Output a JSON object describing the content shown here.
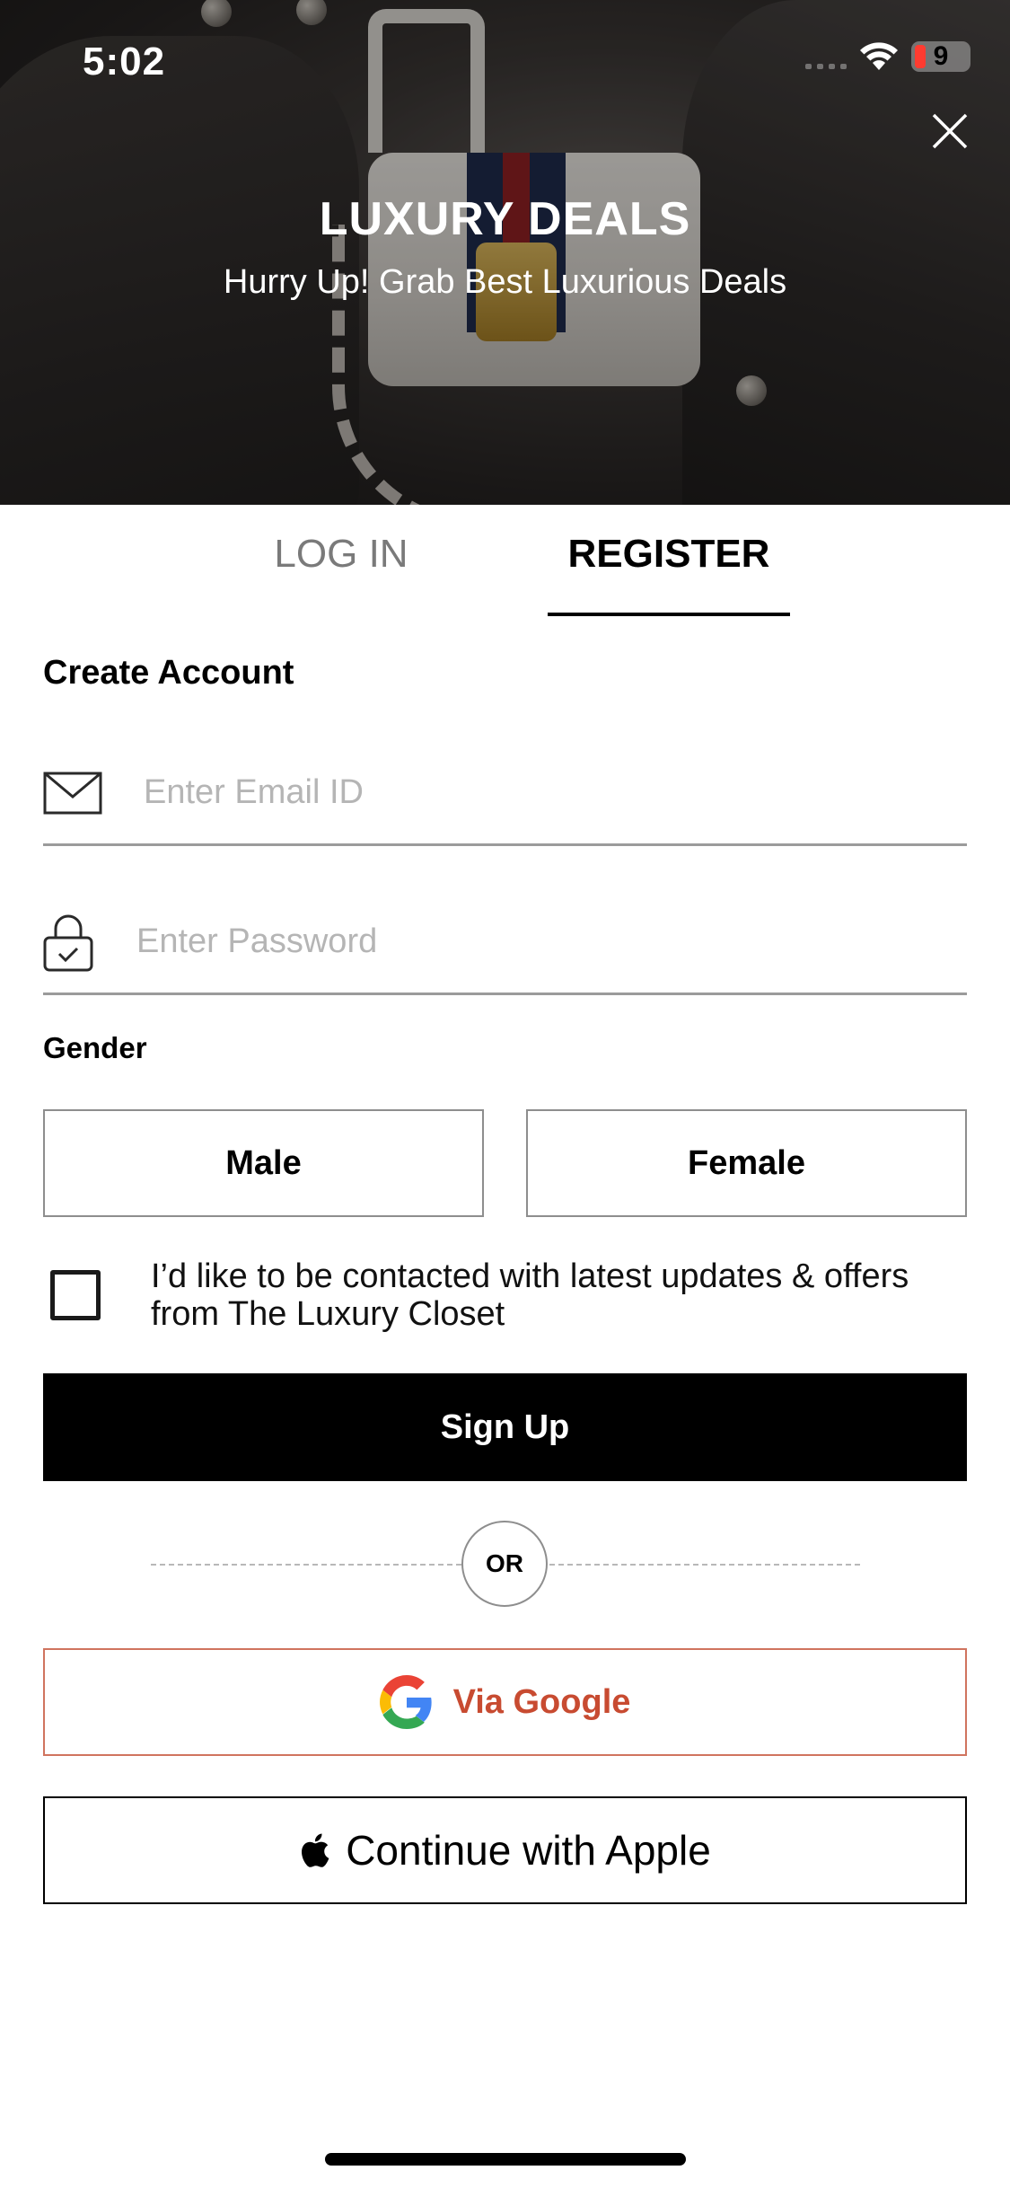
{
  "status_bar": {
    "time": "5:02",
    "battery_level": "9"
  },
  "hero": {
    "title": "LUXURY DEALS",
    "subtitle": "Hurry Up! Grab Best Luxurious Deals"
  },
  "tabs": [
    {
      "label": "LOG IN",
      "active": false
    },
    {
      "label": "REGISTER",
      "active": true
    }
  ],
  "form": {
    "title": "Create Account",
    "email": {
      "value": "",
      "placeholder": "Enter Email ID"
    },
    "password": {
      "value": "",
      "placeholder": "Enter Password"
    },
    "gender": {
      "label": "Gender",
      "options": [
        "Male",
        "Female"
      ]
    },
    "consent": {
      "checked": false,
      "text": "I’d like to be contacted with latest updates & offers from The Luxury Closet"
    },
    "signup_label": "Sign Up"
  },
  "divider": {
    "label": "OR"
  },
  "social": {
    "google_label": "Via Google",
    "apple_label": "Continue with Apple"
  },
  "icons": [
    "close-icon",
    "mail-icon",
    "lock-icon",
    "google-icon",
    "apple-icon",
    "wifi-icon",
    "signal-icon",
    "battery-icon"
  ],
  "colors": {
    "google_accent": "#c84b31",
    "google_border": "#d0745f",
    "primary": "#000000",
    "battery_low": "#ff3b30"
  }
}
